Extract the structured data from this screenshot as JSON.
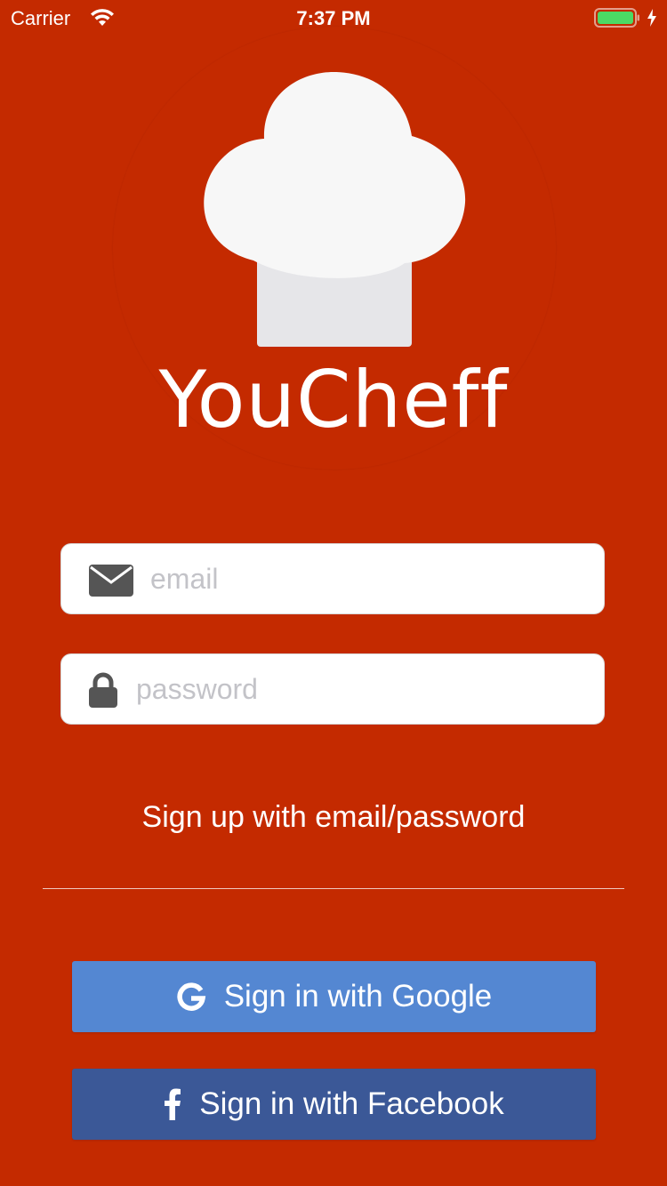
{
  "status_bar": {
    "carrier": "Carrier",
    "time": "7:37 PM",
    "battery_color": "#4cd964"
  },
  "brand": {
    "app_name": "YouCheff",
    "logo_icon": "chef-hat-icon",
    "background_color": "#c42a00"
  },
  "login_form": {
    "email": {
      "icon": "envelope-icon",
      "placeholder": "email",
      "value": ""
    },
    "password": {
      "icon": "lock-icon",
      "placeholder": "password",
      "value": ""
    },
    "signup_link": "Sign up with email/password"
  },
  "social": {
    "google": {
      "icon": "google-g-icon",
      "label": "Sign in with Google",
      "color": "#5487d2"
    },
    "facebook": {
      "icon": "facebook-f-icon",
      "label": "Sign in with Facebook",
      "color": "#3b5897"
    }
  }
}
